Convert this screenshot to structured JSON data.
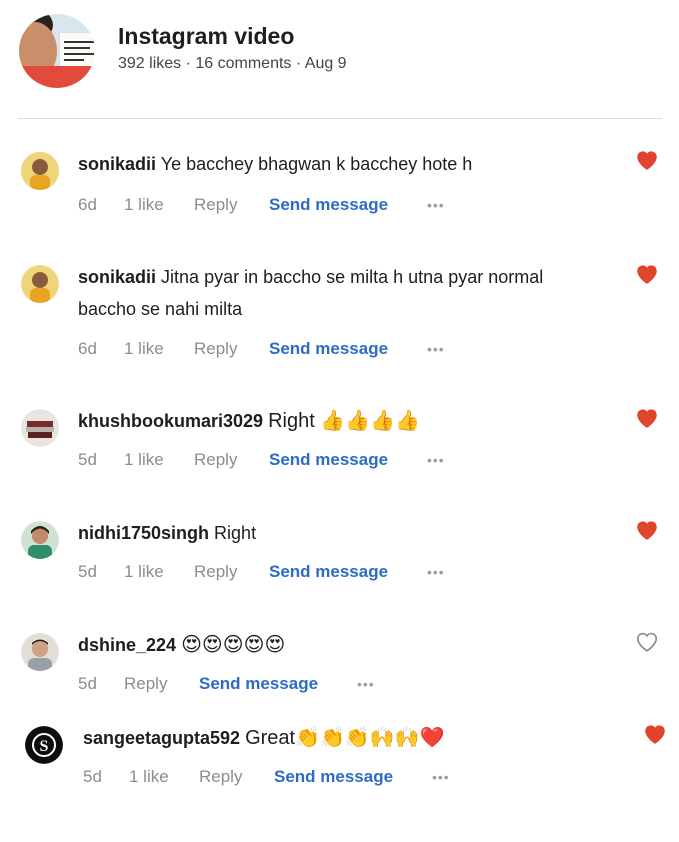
{
  "post": {
    "title": "Instagram video",
    "likes": "392 likes",
    "comments": "16 comments",
    "date": "Aug 9",
    "separator": " · "
  },
  "colors": {
    "heart_red": "#e0442f",
    "link_blue": "#2d6cc4",
    "muted": "#8a8d91"
  },
  "comments": [
    {
      "user": "sonikadii",
      "text": "Ye bacchey bhagwan k bacchey hote h",
      "time": "6d",
      "likes": "1 like",
      "reply": "Reply",
      "send": "Send message",
      "liked": true
    },
    {
      "user": "sonikadii",
      "text": "Jitna pyar in baccho se milta h utna pyar normal",
      "text2": "baccho se nahi milta",
      "time": "6d",
      "likes": "1 like",
      "reply": "Reply",
      "send": "Send message",
      "liked": true
    },
    {
      "user": "khushbookumari3029",
      "text": "Right 👍👍👍👍",
      "time": "5d",
      "likes": "1 like",
      "reply": "Reply",
      "send": "Send message",
      "liked": true
    },
    {
      "user": "nidhi1750singh",
      "text": "Right",
      "time": "5d",
      "likes": "1 like",
      "reply": "Reply",
      "send": "Send message",
      "liked": true
    },
    {
      "user": "dshine_224",
      "text": "😍😍😍😍😍",
      "time": "5d",
      "reply": "Reply",
      "send": "Send message",
      "liked": false
    },
    {
      "user": "sangeetagupta592",
      "text": "Great👏👏👏🙌🙌❤️",
      "time": "5d",
      "likes": "1 like",
      "reply": "Reply",
      "send": "Send message",
      "liked": true
    }
  ],
  "more_icon": "more-horizontal-icon",
  "heart_icon": "heart-icon"
}
